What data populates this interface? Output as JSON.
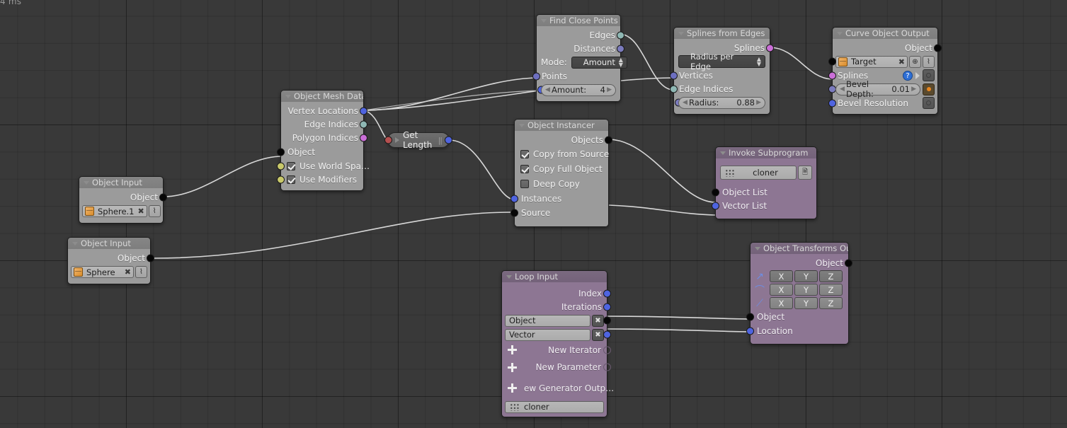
{
  "hud": {
    "timer": "4 ms"
  },
  "editor": {
    "name": "animation-nodes-editor",
    "background": "#393939",
    "grid_color": "#2d2d2d"
  },
  "colors": {
    "node_grey_body": "#9b9b9b",
    "node_grey_header": "#838383",
    "node_purple_body": "#8d7693",
    "node_purple_header": "#776380",
    "socket_object": "#060606",
    "socket_vector": "#4f64e0",
    "socket_integer": "#6d6fc0",
    "socket_edge": "#8fb8b4",
    "socket_spline": "#cb6fd8",
    "socket_boolean": "#c8c86a",
    "socket_float": "#7b7bbd",
    "link": "#d8d8d8"
  },
  "nodes": {
    "find_close_points": {
      "title": "Find Close Points",
      "outputs": [
        "Edges",
        "Distances"
      ],
      "mode_label": "Mode:",
      "mode_value": "Amount",
      "inputs": [
        "Points"
      ],
      "amount_label": "Amount:",
      "amount_value": "4"
    },
    "splines_from_edges": {
      "title": "Splines from Edges",
      "outputs": [
        "Splines"
      ],
      "type_value": "Radius per Edge",
      "inputs": [
        "Vertices",
        "Edge Indices"
      ],
      "radius_label": "Radius:",
      "radius_value": "0.88"
    },
    "curve_object_output": {
      "title": "Curve Object Output",
      "outputs": [
        "Object"
      ],
      "target_label": "Target",
      "target_icon": "cube-icon",
      "splines_label": "Splines",
      "bevel_depth_label": "Bevel Depth:",
      "bevel_depth_value": "0.01",
      "bevel_resolution_label": "Bevel Resolution"
    },
    "object_mesh_data": {
      "title": "Object Mesh Data",
      "outputs": [
        "Vertex Locations",
        "Edge Indices",
        "Polygon Indices"
      ],
      "inputs": [
        "Object"
      ],
      "checkboxes": [
        {
          "label": "Use World Spa…",
          "checked": true
        },
        {
          "label": "Use Modifiers",
          "checked": true
        }
      ]
    },
    "get_length": {
      "title": "Get Length"
    },
    "object_instancer": {
      "title": "Object Instancer",
      "outputs": [
        "Objects"
      ],
      "checkboxes": [
        {
          "label": "Copy from Source",
          "checked": true
        },
        {
          "label": "Copy Full Object",
          "checked": true
        },
        {
          "label": "Deep Copy",
          "checked": false
        }
      ],
      "inputs": [
        "Instances",
        "Source"
      ]
    },
    "invoke_subprogram": {
      "title": "Invoke Subprogram",
      "subprogram_value": "cloner",
      "inputs": [
        "Object List",
        "Vector List"
      ]
    },
    "object_input_1": {
      "title": "Object Input",
      "outputs": [
        "Object"
      ],
      "object_value": "Sphere.1"
    },
    "object_input_2": {
      "title": "Object Input",
      "outputs": [
        "Object"
      ],
      "object_value": "Sphere"
    },
    "loop_input": {
      "title": "Loop Input",
      "outputs": [
        "Index",
        "Iterations"
      ],
      "iterators": [
        "Object",
        "Vector"
      ],
      "new_iterator_label": "New Iterator",
      "new_parameter_label": "New Parameter",
      "new_generator_output_label": "ew Generator Outp…",
      "subprogram_value": "cloner"
    },
    "object_transforms_output": {
      "title": "Object Transforms Out…",
      "outputs": [
        "Object"
      ],
      "axis_rows": [
        {
          "icon": "location-arrow-icon",
          "axes": [
            "X",
            "Y",
            "Z"
          ],
          "enabled": true
        },
        {
          "icon": "rotation-arc-icon",
          "axes": [
            "X",
            "Y",
            "Z"
          ],
          "enabled": false
        },
        {
          "icon": "scale-icon",
          "axes": [
            "X",
            "Y",
            "Z"
          ],
          "enabled": false
        }
      ],
      "inputs": [
        "Object",
        "Location"
      ]
    }
  }
}
